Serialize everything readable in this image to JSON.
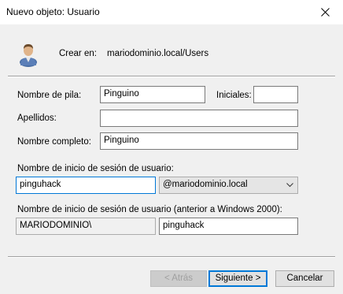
{
  "window": {
    "title": "Nuevo objeto: Usuario",
    "close_icon": "close-icon"
  },
  "header": {
    "icon": "user-icon",
    "create_in_label": "Crear en:",
    "create_in_value": "mariodominio.local/Users"
  },
  "form": {
    "first_name_label": "Nombre de pila:",
    "first_name_value": "Pinguino",
    "initials_label": "Iniciales:",
    "initials_value": "",
    "last_name_label": "Apellidos:",
    "last_name_value": "",
    "full_name_label": "Nombre completo:",
    "full_name_value": "Pinguino",
    "logon_name_label": "Nombre de inicio de sesión de usuario:",
    "logon_name_value": "pinguhack",
    "domain_suffix_value": "@mariodominio.local",
    "pre2000_label": "Nombre de inicio de sesión de usuario (anterior a Windows 2000):",
    "pre2000_domain_value": "MARIODOMINIO\\",
    "pre2000_name_value": "pinguhack"
  },
  "buttons": {
    "back_label": "< Atrás",
    "next_label": "Siguiente >",
    "cancel_label": "Cancelar"
  },
  "colors": {
    "focus_accent": "#0078d7"
  }
}
